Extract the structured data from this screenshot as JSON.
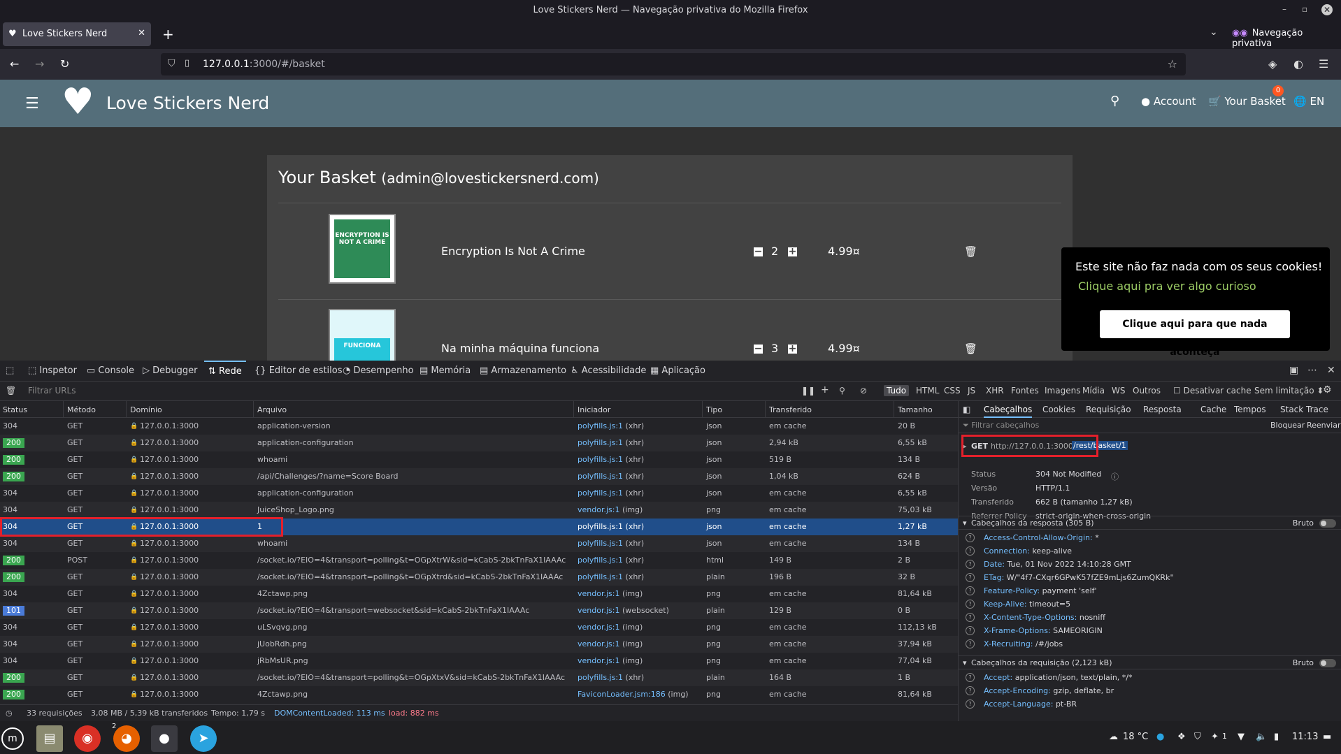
{
  "window": {
    "title": "Love Stickers Nerd — Navegação privativa do Mozilla Firefox"
  },
  "tab": {
    "label": "Love Stickers Nerd",
    "new_tab": "+"
  },
  "private_label": "Navegação privativa",
  "url": {
    "host": "127.0.0.1",
    "rest": ":3000/#/basket"
  },
  "app": {
    "brand": "Love Stickers Nerd",
    "account": "Account",
    "basket": "Your Basket",
    "basket_count": "0",
    "lang": "EN"
  },
  "basket": {
    "title": "Your Basket",
    "email": "(admin@lovestickersnerd.com)",
    "items": [
      {
        "name": "Encryption Is Not A Crime",
        "qty": "2",
        "price": "4.99¤",
        "thumb_text": "ENCRYPTION IS NOT A CRIME"
      },
      {
        "name": "Na minha máquina funciona",
        "qty": "3",
        "price": "4.99¤",
        "thumb_text": "FUNCIONA"
      }
    ]
  },
  "cookie": {
    "message": "Este site não faz nada com os seus cookies!",
    "link": "Clique aqui pra ver algo curioso",
    "button": "Clique aqui para que nada aconteça"
  },
  "devtools": {
    "tools": [
      "Inspetor",
      "Console",
      "Debugger",
      "Rede",
      "Editor de estilos",
      "Desempenho",
      "Memória",
      "Armazenamento",
      "Acessibilidade",
      "Aplicação"
    ],
    "filter_placeholder": "Filtrar URLs",
    "type_filters": [
      "Tudo",
      "HTML",
      "CSS",
      "JS",
      "XHR",
      "Fontes",
      "Imagens",
      "Mídia",
      "WS",
      "Outros"
    ],
    "disable_cache": "Desativar cache",
    "throttle": "Sem limitação",
    "columns": [
      "Status",
      "Método",
      "Domínio",
      "Arquivo",
      "Iniciador",
      "Tipo",
      "Transferido",
      "Tamanho"
    ],
    "requests": [
      {
        "status": "304",
        "method": "GET",
        "domain": "127.0.0.1:3000",
        "file": "application-version",
        "initiator": "polyfills.js:1",
        "initiator_type": "(xhr)",
        "type": "json",
        "transferred": "em cache",
        "size": "20 B"
      },
      {
        "status": "200",
        "method": "GET",
        "domain": "127.0.0.1:3000",
        "file": "application-configuration",
        "initiator": "polyfills.js:1",
        "initiator_type": "(xhr)",
        "type": "json",
        "transferred": "2,94 kB",
        "size": "6,55 kB"
      },
      {
        "status": "200",
        "method": "GET",
        "domain": "127.0.0.1:3000",
        "file": "whoami",
        "initiator": "polyfills.js:1",
        "initiator_type": "(xhr)",
        "type": "json",
        "transferred": "519 B",
        "size": "134 B"
      },
      {
        "status": "200",
        "method": "GET",
        "domain": "127.0.0.1:3000",
        "file": "/api/Challenges/?name=Score Board",
        "initiator": "polyfills.js:1",
        "initiator_type": "(xhr)",
        "type": "json",
        "transferred": "1,04 kB",
        "size": "624 B"
      },
      {
        "status": "304",
        "method": "GET",
        "domain": "127.0.0.1:3000",
        "file": "application-configuration",
        "initiator": "polyfills.js:1",
        "initiator_type": "(xhr)",
        "type": "json",
        "transferred": "em cache",
        "size": "6,55 kB"
      },
      {
        "status": "304",
        "method": "GET",
        "domain": "127.0.0.1:3000",
        "file": "JuiceShop_Logo.png",
        "initiator": "vendor.js:1",
        "initiator_type": "(img)",
        "type": "png",
        "transferred": "em cache",
        "size": "75,03 kB"
      },
      {
        "status": "304",
        "method": "GET",
        "domain": "127.0.0.1:3000",
        "file": "1",
        "initiator": "polyfills.js:1",
        "initiator_type": "(xhr)",
        "type": "json",
        "transferred": "em cache",
        "size": "1,27 kB"
      },
      {
        "status": "304",
        "method": "GET",
        "domain": "127.0.0.1:3000",
        "file": "whoami",
        "initiator": "polyfills.js:1",
        "initiator_type": "(xhr)",
        "type": "json",
        "transferred": "em cache",
        "size": "134 B"
      },
      {
        "status": "200",
        "method": "POST",
        "domain": "127.0.0.1:3000",
        "file": "/socket.io/?EIO=4&transport=polling&t=OGpXtrW&sid=kCabS-2bkTnFaX1IAAAc",
        "initiator": "polyfills.js:1",
        "initiator_type": "(xhr)",
        "type": "html",
        "transferred": "149 B",
        "size": "2 B"
      },
      {
        "status": "200",
        "method": "GET",
        "domain": "127.0.0.1:3000",
        "file": "/socket.io/?EIO=4&transport=polling&t=OGpXtrd&sid=kCabS-2bkTnFaX1IAAAc",
        "initiator": "polyfills.js:1",
        "initiator_type": "(xhr)",
        "type": "plain",
        "transferred": "196 B",
        "size": "32 B"
      },
      {
        "status": "304",
        "method": "GET",
        "domain": "127.0.0.1:3000",
        "file": "4Zctawp.png",
        "initiator": "vendor.js:1",
        "initiator_type": "(img)",
        "type": "png",
        "transferred": "em cache",
        "size": "81,64 kB"
      },
      {
        "status": "101",
        "method": "GET",
        "domain": "127.0.0.1:3000",
        "file": "/socket.io/?EIO=4&transport=websocket&sid=kCabS-2bkTnFaX1IAAAc",
        "initiator": "vendor.js:1",
        "initiator_type": "(websocket)",
        "type": "plain",
        "transferred": "129 B",
        "size": "0 B"
      },
      {
        "status": "304",
        "method": "GET",
        "domain": "127.0.0.1:3000",
        "file": "uLSvqvg.png",
        "initiator": "vendor.js:1",
        "initiator_type": "(img)",
        "type": "png",
        "transferred": "em cache",
        "size": "112,13 kB"
      },
      {
        "status": "304",
        "method": "GET",
        "domain": "127.0.0.1:3000",
        "file": "jUobRdh.png",
        "initiator": "vendor.js:1",
        "initiator_type": "(img)",
        "type": "png",
        "transferred": "em cache",
        "size": "37,94 kB"
      },
      {
        "status": "304",
        "method": "GET",
        "domain": "127.0.0.1:3000",
        "file": "jRbMsUR.png",
        "initiator": "vendor.js:1",
        "initiator_type": "(img)",
        "type": "png",
        "transferred": "em cache",
        "size": "77,04 kB"
      },
      {
        "status": "200",
        "method": "GET",
        "domain": "127.0.0.1:3000",
        "file": "/socket.io/?EIO=4&transport=polling&t=OGpXtxV&sid=kCabS-2bkTnFaX1IAAAc",
        "initiator": "polyfills.js:1",
        "initiator_type": "(xhr)",
        "type": "plain",
        "transferred": "164 B",
        "size": "1 B"
      },
      {
        "status": "200",
        "method": "GET",
        "domain": "127.0.0.1:3000",
        "file": "4Zctawp.png",
        "initiator": "FaviconLoader.jsm:186",
        "initiator_type": "(img)",
        "type": "png",
        "transferred": "em cache",
        "size": "81,64 kB"
      }
    ],
    "status": {
      "requests": "33 requisições",
      "transferred": "3,08 MB / 5,39 kB transferidos",
      "time": "Tempo: 1,79 s",
      "dcl": "DOMContentLoaded: 113 ms",
      "load": "load: 882 ms"
    },
    "side": {
      "tabs": [
        "Cabeçalhos",
        "Cookies",
        "Requisição",
        "Resposta",
        "Cache",
        "Tempos",
        "Stack Trace"
      ],
      "filter_placeholder": "Filtrar cabeçalhos",
      "block": "Bloquear",
      "resend": "Reenviar",
      "method": "GET",
      "url_base": "http://127.0.0.1:3000",
      "url_path": "/rest/basket/1",
      "summary": [
        {
          "k": "Status",
          "v": "304 Not Modified"
        },
        {
          "k": "Versão",
          "v": "HTTP/1.1"
        },
        {
          "k": "Transferido",
          "v": "662 B (tamanho 1,27 kB)"
        },
        {
          "k": "Referrer Policy",
          "v": "strict-origin-when-cross-origin"
        }
      ],
      "resp_title": "Cabeçalhos da resposta (305 B)",
      "raw": "Bruto",
      "resp_headers": [
        {
          "k": "Access-Control-Allow-Origin:",
          "v": "*"
        },
        {
          "k": "Connection:",
          "v": "keep-alive"
        },
        {
          "k": "Date:",
          "v": "Tue, 01 Nov 2022 14:10:28 GMT"
        },
        {
          "k": "ETag:",
          "v": "W/\"4f7-CXqr6GPwK57fZE9mLjs6ZumQKRk\""
        },
        {
          "k": "Feature-Policy:",
          "v": "payment 'self'"
        },
        {
          "k": "Keep-Alive:",
          "v": "timeout=5"
        },
        {
          "k": "X-Content-Type-Options:",
          "v": "nosniff"
        },
        {
          "k": "X-Frame-Options:",
          "v": "SAMEORIGIN"
        },
        {
          "k": "X-Recruiting:",
          "v": "/#/jobs"
        }
      ],
      "req_title": "Cabeçalhos da requisição (2,123 kB)",
      "req_headers": [
        {
          "k": "Accept:",
          "v": "application/json, text/plain, */*"
        },
        {
          "k": "Accept-Encoding:",
          "v": "gzip, deflate, br"
        },
        {
          "k": "Accept-Language:",
          "v": "pt-BR"
        }
      ]
    }
  },
  "taskbar": {
    "weather": "18 °C",
    "clock": "11:13",
    "firefox_count": "2",
    "tray_count": "1"
  }
}
